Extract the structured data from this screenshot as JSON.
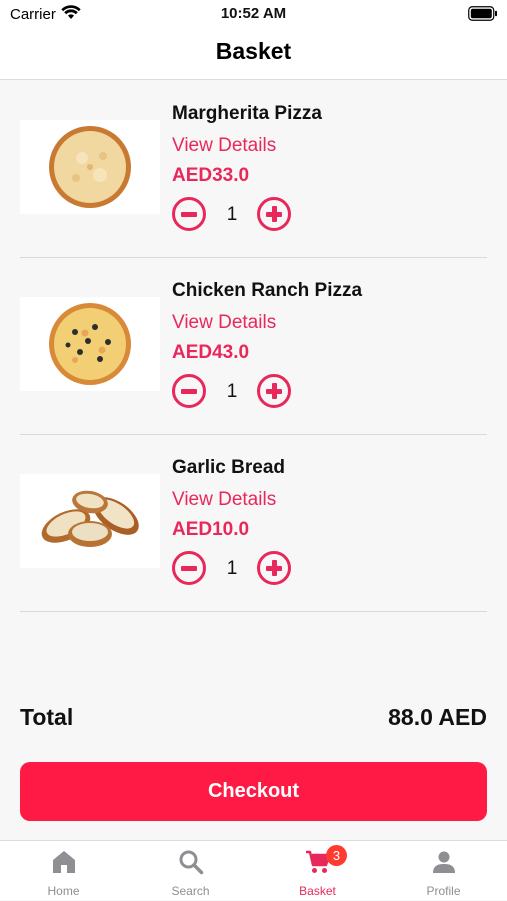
{
  "status_bar": {
    "carrier": "Carrier",
    "time": "10:52 AM"
  },
  "header": {
    "title": "Basket"
  },
  "basket": {
    "items": [
      {
        "name": "Margherita Pizza",
        "details_link": "View Details",
        "price": "AED33.0",
        "quantity": "1",
        "image": "margherita-pizza-photo"
      },
      {
        "name": "Chicken Ranch Pizza",
        "details_link": "View Details",
        "price": "AED43.0",
        "quantity": "1",
        "image": "chicken-ranch-pizza-photo"
      },
      {
        "name": "Garlic Bread",
        "details_link": "View Details",
        "price": "AED10.0",
        "quantity": "1",
        "image": "garlic-bread-photo"
      }
    ]
  },
  "summary": {
    "total_label": "Total",
    "total_value": "88.0 AED"
  },
  "checkout": {
    "label": "Checkout"
  },
  "tab_bar": {
    "tabs": [
      {
        "label": "Home",
        "icon": "home-icon"
      },
      {
        "label": "Search",
        "icon": "search-icon"
      },
      {
        "label": "Basket",
        "icon": "cart-icon",
        "badge": "3"
      },
      {
        "label": "Profile",
        "icon": "person-icon"
      }
    ],
    "active_tab": "Basket"
  },
  "colors": {
    "accent": "#e8285a",
    "checkout": "#ff1a45",
    "badge": "#ff3b30",
    "inactive_tab": "#8e8e93"
  }
}
